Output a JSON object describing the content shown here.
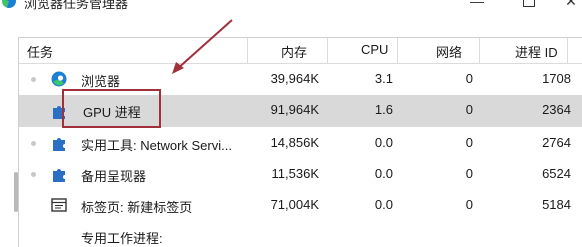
{
  "window": {
    "title": "浏览器任务管理器",
    "min_glyph": "—",
    "close_glyph": "✕"
  },
  "columns": [
    {
      "label": "任务"
    },
    {
      "label": "内存"
    },
    {
      "label": "CPU"
    },
    {
      "label": "网络"
    },
    {
      "label": "进程 ID"
    }
  ],
  "rows": [
    {
      "task": "浏览器",
      "icon": "edge-browser-icon",
      "memory": "39,964K",
      "cpu": "3.1",
      "network": "0",
      "pid": "1708"
    },
    {
      "task": "GPU 进程",
      "icon": "puzzle-piece-icon",
      "memory": "91,964K",
      "cpu": "1.6",
      "network": "0",
      "pid": "2364",
      "selected": true
    },
    {
      "task": "实用工具: Network Servi...",
      "icon": "puzzle-piece-icon",
      "memory": "14,856K",
      "cpu": "0.0",
      "network": "0",
      "pid": "2764"
    },
    {
      "task": "备用呈现器",
      "icon": "puzzle-piece-icon",
      "memory": "11,536K",
      "cpu": "0.0",
      "network": "0",
      "pid": "6524"
    },
    {
      "task": "标签页: 新建标签页",
      "icon": "tab-page-icon",
      "memory": "71,004K",
      "cpu": "0.0",
      "network": "0",
      "pid": "5184"
    },
    {
      "task": "专用工作进程:",
      "icon": "",
      "memory": "",
      "cpu": "",
      "network": "",
      "pid": ""
    }
  ],
  "colors": {
    "selection": "#d9d9d9",
    "annotation": "#a0303a",
    "edge_blue": "#1c7fd6",
    "edge_green": "#3ec46d",
    "puzzle_blue": "#2b6fc4"
  }
}
